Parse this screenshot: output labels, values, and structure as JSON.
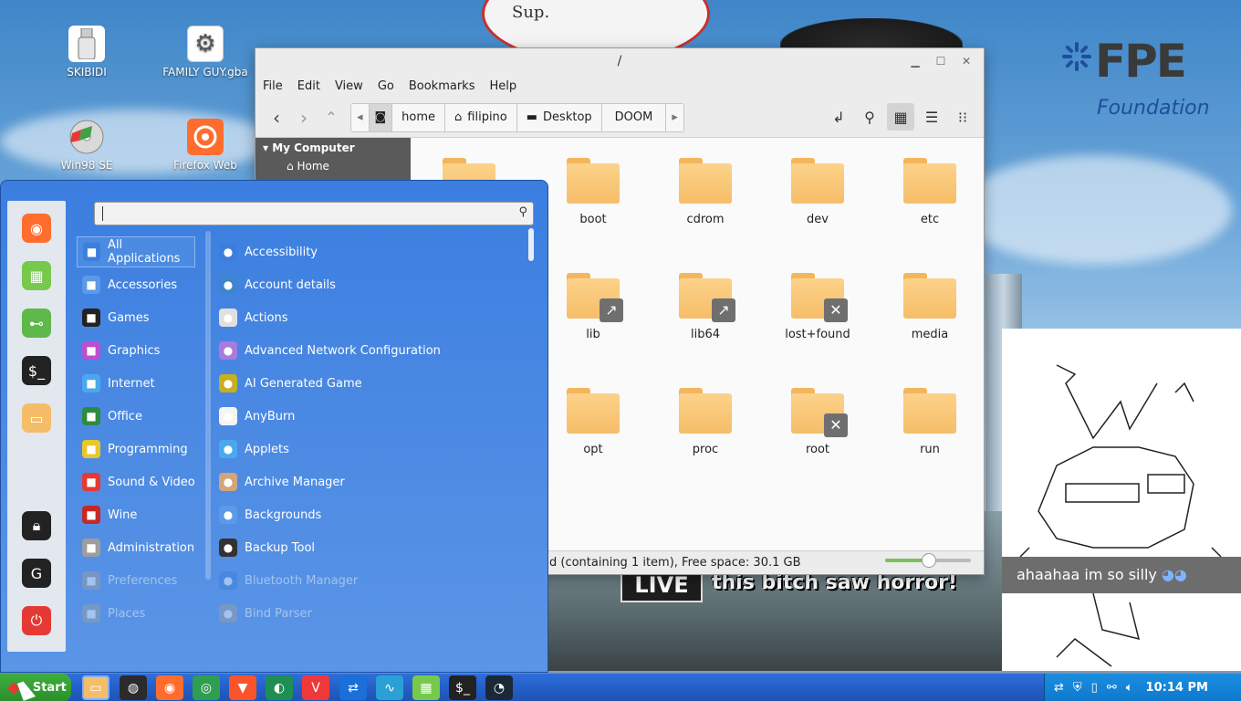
{
  "desktop": {
    "icons": [
      {
        "label": "SKIBIDI",
        "icon": "usb-drive-icon"
      },
      {
        "label": "FAMILY GUY.gba",
        "icon": "gear-icon"
      },
      {
        "label": "Win98 SE",
        "icon": "cd-icon"
      },
      {
        "label": "Firefox Web",
        "icon": "firefox-icon"
      }
    ],
    "logo_sup": "Sup.",
    "fpe_logo": {
      "big": "FPE",
      "small": "Foundation"
    },
    "doodle_caption": "ahaahaa im so silly",
    "live_banner": {
      "live": "LIVE",
      "text": "this bitch saw horror!"
    }
  },
  "file_manager": {
    "title": "/",
    "menu": [
      "File",
      "Edit",
      "View",
      "Go",
      "Bookmarks",
      "Help"
    ],
    "breadcrumbs": [
      "home",
      "filipino",
      "Desktop",
      "DOOM"
    ],
    "sidebar": {
      "header": "My Computer",
      "item": "Home"
    },
    "folders": [
      {
        "name": "boot",
        "badge": ""
      },
      {
        "name": "cdrom",
        "badge": ""
      },
      {
        "name": "dev",
        "badge": ""
      },
      {
        "name": "etc",
        "badge": ""
      },
      {
        "name": "lib",
        "badge": "↗"
      },
      {
        "name": "lib64",
        "badge": "↗"
      },
      {
        "name": "lost+found",
        "badge": "✕"
      },
      {
        "name": "media",
        "badge": ""
      },
      {
        "name": "opt",
        "badge": ""
      },
      {
        "name": "proc",
        "badge": ""
      },
      {
        "name": "root",
        "badge": "✕"
      },
      {
        "name": "run",
        "badge": ""
      }
    ],
    "status": "d (containing 1 item), Free space: 30.1 GB",
    "zoom_level": 0.5
  },
  "start_menu": {
    "search_placeholder": "",
    "categories": [
      {
        "label": "All Applications",
        "icon": "grid-icon",
        "color": "#3b7ee0"
      },
      {
        "label": "Accessories",
        "icon": "tools-icon",
        "color": "#5b9ae8"
      },
      {
        "label": "Games",
        "icon": "gamepad-icon",
        "color": "#222222"
      },
      {
        "label": "Graphics",
        "icon": "palette-icon",
        "color": "#c04ed0"
      },
      {
        "label": "Internet",
        "icon": "cloud-icon",
        "color": "#4aa8ef"
      },
      {
        "label": "Office",
        "icon": "office-icon",
        "color": "#2e8b3e"
      },
      {
        "label": "Programming",
        "icon": "code-icon",
        "color": "#e8c72a"
      },
      {
        "label": "Sound & Video",
        "icon": "play-icon",
        "color": "#e53935"
      },
      {
        "label": "Wine",
        "icon": "wine-icon",
        "color": "#c62828"
      },
      {
        "label": "Administration",
        "icon": "admin-icon",
        "color": "#9e9e9e"
      },
      {
        "label": "Preferences",
        "icon": "preferences-icon",
        "color": "#9e9e9e"
      },
      {
        "label": "Places",
        "icon": "places-icon",
        "color": "#9e9e9e"
      }
    ],
    "apps": [
      {
        "label": "Accessibility",
        "icon": "accessibility-icon",
        "color": "#3b7ee0"
      },
      {
        "label": "Account details",
        "icon": "user-icon",
        "color": "#3e84cf"
      },
      {
        "label": "Actions",
        "icon": "list-icon",
        "color": "#e0e0e0"
      },
      {
        "label": "Advanced Network Configuration",
        "icon": "network-icon",
        "color": "#a77be0"
      },
      {
        "label": "AI Generated Game",
        "icon": "cactus-icon",
        "color": "#c4b020"
      },
      {
        "label": "AnyBurn",
        "icon": "disc-icon",
        "color": "#f5f5f5"
      },
      {
        "label": "Applets",
        "icon": "applets-icon",
        "color": "#4aa8ef"
      },
      {
        "label": "Archive Manager",
        "icon": "archive-icon",
        "color": "#d2a679"
      },
      {
        "label": "Backgrounds",
        "icon": "image-icon",
        "color": "#5b9ae8"
      },
      {
        "label": "Backup Tool",
        "icon": "backup-icon",
        "color": "#333333"
      },
      {
        "label": "Bluetooth Manager",
        "icon": "bluetooth-icon",
        "color": "#3b7ee0"
      },
      {
        "label": "Bind Parser",
        "icon": "bind-icon",
        "color": "#9e9e9e"
      }
    ],
    "favorites": [
      {
        "icon": "firefox-icon",
        "color": "#ff6d2e"
      },
      {
        "icon": "grid-green-icon",
        "color": "#77c94c"
      },
      {
        "icon": "toggle-icon",
        "color": "#5fb84a"
      },
      {
        "icon": "terminal-icon",
        "color": "#222222"
      },
      {
        "icon": "folder-icon",
        "color": "#f6bd68"
      },
      {
        "icon": "lock-icon",
        "color": "#222222"
      },
      {
        "icon": "logout-icon",
        "color": "#222222"
      },
      {
        "icon": "power-icon",
        "color": "#e53935"
      }
    ]
  },
  "taskbar": {
    "start_label": "Start",
    "apps": [
      {
        "icon": "folder-icon",
        "color": "#f6bd68"
      },
      {
        "icon": "obs-icon",
        "color": "#2b2b2b"
      },
      {
        "icon": "firefox-icon",
        "color": "#ff6d2e"
      },
      {
        "icon": "chrome-icon",
        "color": "#2e9e4f"
      },
      {
        "icon": "brave-icon",
        "color": "#fb542b"
      },
      {
        "icon": "edge-dev-icon",
        "color": "#1e8e52"
      },
      {
        "icon": "vivaldi-icon",
        "color": "#ef3939"
      },
      {
        "icon": "remote-icon",
        "color": "#1a6fd8"
      },
      {
        "icon": "monitor-icon",
        "color": "#2aa0d6"
      },
      {
        "icon": "grid-green-icon",
        "color": "#77c94c"
      },
      {
        "icon": "terminal-icon",
        "color": "#222222"
      },
      {
        "icon": "steam-icon",
        "color": "#1b2838"
      }
    ],
    "tray_time": "10:14 PM"
  }
}
